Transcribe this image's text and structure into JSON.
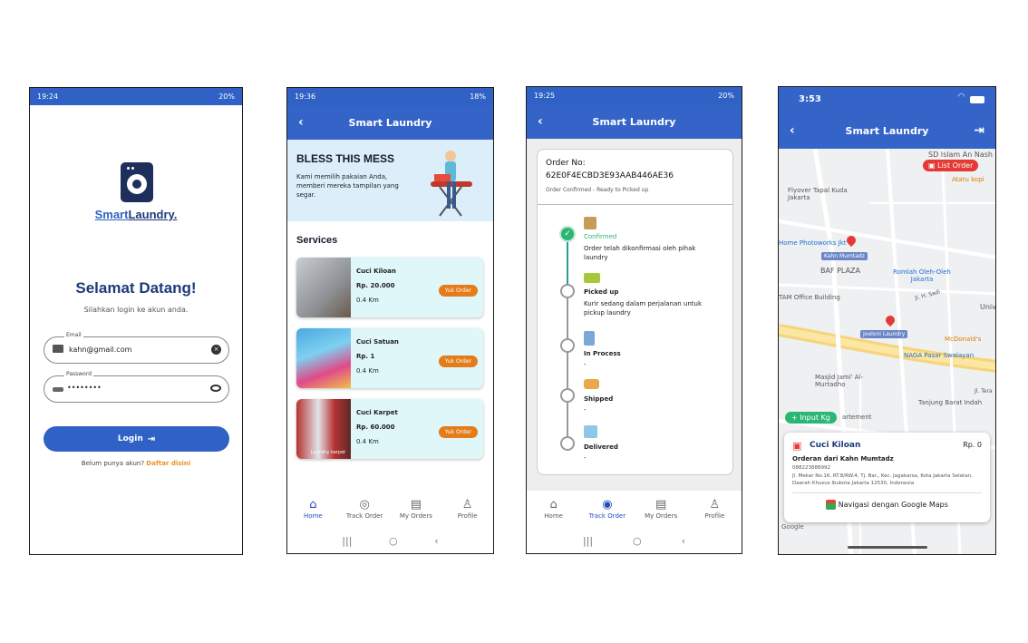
{
  "screen1": {
    "status_time": "19:24",
    "status_right": "20%",
    "brand_part1": "Smart",
    "brand_part2": "Laundry.",
    "welcome": "Selamat Datang!",
    "subtitle": "Silahkan login ke akun anda.",
    "email_label": "Email",
    "email_value": "kahn@gmail.com",
    "password_label": "Password",
    "password_value": "••••••••",
    "login_label": "Login",
    "register_prompt": "Belum punya akun?",
    "register_link": "Daftar disini"
  },
  "screen2": {
    "status_time": "19:36",
    "status_right": "18%",
    "title": "Smart Laundry",
    "banner_title": "BLESS THIS MESS",
    "banner_text": "Kami memilih pakaian Anda, memberi mereka tampilan yang segar.",
    "services_heading": "Services",
    "services": [
      {
        "name": "Cuci Kiloan",
        "price": "Rp. 20.000",
        "distance": "0.4 Km",
        "button": "Yuk Order"
      },
      {
        "name": "Cuci Satuan",
        "price": "Rp. 1",
        "distance": "0.4 Km",
        "button": "Yuk Order"
      },
      {
        "name": "Cuci Karpet",
        "price": "Rp. 60.000",
        "distance": "0.4 Km",
        "button": "Yuk Order"
      }
    ],
    "carpet_photo_caption": "Laundry karpet",
    "nav": [
      "Home",
      "Track Order",
      "My Orders",
      "Profile"
    ]
  },
  "screen3": {
    "status_time": "19:25",
    "status_right": "20%",
    "title": "Smart Laundry",
    "order_label": "Order No:",
    "order_number": "62E0F4ECBD3E93AAB446AE36",
    "order_status": "Order Confirmed - Ready to Picked up",
    "steps": [
      {
        "title": "Confirmed",
        "desc": "Order telah dikonfirmasi oleh pihak laundry"
      },
      {
        "title": "Picked up",
        "desc": "Kurir sedang dalam perjalanan untuk pickup laundry"
      },
      {
        "title": "In Process",
        "desc": "-"
      },
      {
        "title": "Shipped",
        "desc": "-"
      },
      {
        "title": "Delivered",
        "desc": "-"
      }
    ],
    "nav": [
      "Home",
      "Track Order",
      "My Orders",
      "Profile"
    ]
  },
  "screen4": {
    "status_time": "3:53",
    "title": "Smart Laundry",
    "list_order_label": "List Order",
    "input_kg_label": "+ Input Kg",
    "map_labels": {
      "sd_islam": "SD Islam An Nash",
      "atatu": "Atatu kopi",
      "flyover": "Flyover Tapal Kuda Jakarta",
      "photoworks": "Home Photoworks Jkt",
      "kahn_tag": "Kahn Mumtadz",
      "baf": "BAF PLAZA",
      "romlah": "Romlah Oleh-Oleh Jakarta",
      "tam": "TAM Office Building",
      "univ": "Univ",
      "joeloni": "Joeloni Laundry",
      "mcd": "McDonald's",
      "naga": "NAGA Pasar Swalayan",
      "masjid": "Masjid Jami' Al-Murtadho",
      "tanjung": "Tanjung Barat Indah",
      "partement": "artement",
      "jl_sadi": "Jl. H. Sadi",
      "jl_tera": "Jl. Tera",
      "google": "Google"
    },
    "card_title": "Cuci Kiloan",
    "card_price": "Rp. 0",
    "card_customer": "Orderan dari Kahn Mumtadz",
    "card_phone": "088223888992",
    "card_address": "Jl. Mekar No.16, RT.8/RW.4, Tj. Bar., Kec. Jagakarsa, Kota Jakarta Selatan, Daerah Khusus Ibukota Jakarta 12530, Indonesia",
    "card_nav": "Navigasi dengan Google Maps"
  },
  "colors": {
    "primary": "#3564c9",
    "status_bar": "#2f62c4",
    "accent_orange": "#e57c1a",
    "success_green": "#2bb673",
    "track_line": "#2a9d8f",
    "brand_dark": "#1d3a7a",
    "map_pin_red": "#e53935"
  }
}
